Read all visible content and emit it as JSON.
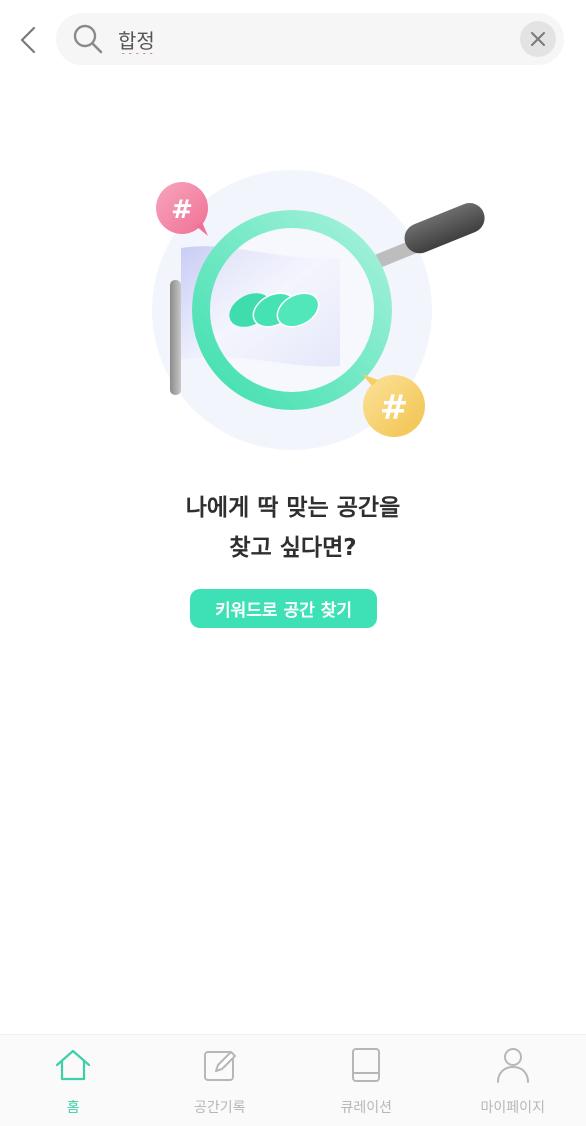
{
  "search": {
    "value": "합정"
  },
  "empty_state": {
    "title_line1": "나에게 딱 맞는 공간을",
    "title_line2": "찾고 싶다면?",
    "cta_label": "키워드로 공간 찾기",
    "illustration_tag_pink": "#",
    "illustration_tag_yellow": "#"
  },
  "nav": {
    "items": [
      {
        "label": "홈",
        "icon": "home-icon",
        "active": true
      },
      {
        "label": "공간기록",
        "icon": "edit-icon",
        "active": false
      },
      {
        "label": "큐레이션",
        "icon": "book-icon",
        "active": false
      },
      {
        "label": "마이페이지",
        "icon": "person-icon",
        "active": false
      }
    ]
  },
  "colors": {
    "accent": "#3ee0b6",
    "nav_active": "#3ccfa8",
    "nav_inactive": "#b7b7b7",
    "title_text": "#2f2f2f",
    "tag_pink": "#f27ea0",
    "tag_yellow": "#f5cf66"
  }
}
